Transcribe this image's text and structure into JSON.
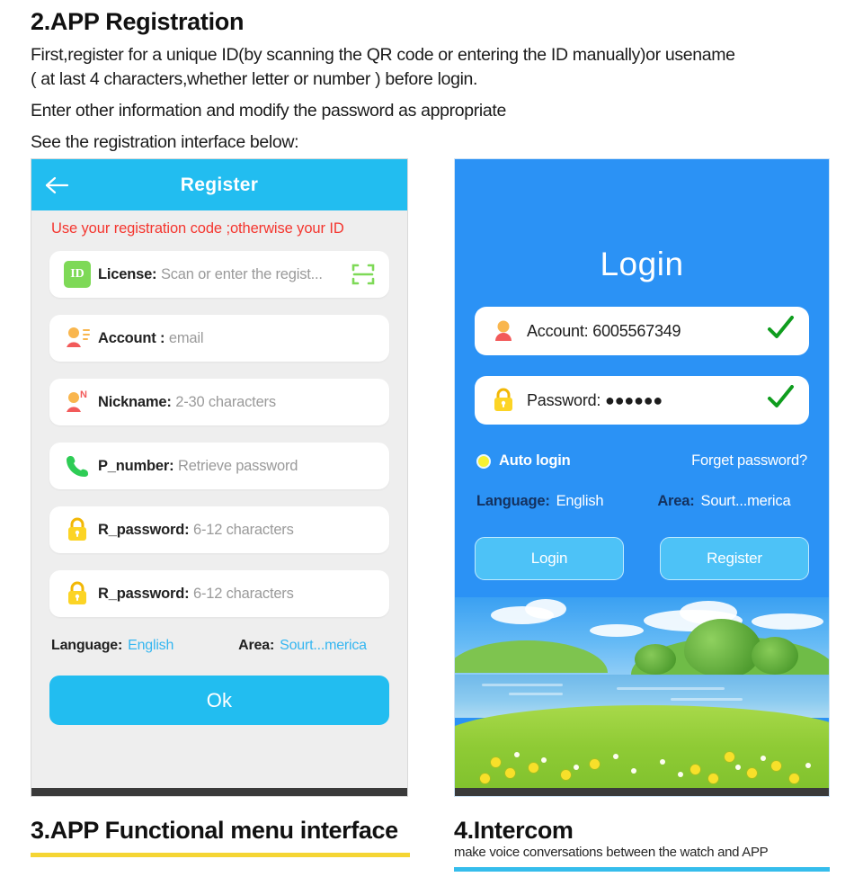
{
  "document": {
    "heading": "2.APP Registration",
    "paragraphs": [
      "First,register for a unique ID(by scanning the QR code or entering the ID manually)or usename",
      "( at last 4 characters,whether letter or number ) before login.",
      "Enter other information and modify the password as appropriate",
      "See the registration interface below:"
    ]
  },
  "register_screen": {
    "back_icon": "arrow-left-icon",
    "title": "Register",
    "warning": "Use your registration code ;otherwise your ID",
    "header_color": "#22bdf0",
    "background_color": "#eeeeee",
    "fields": [
      {
        "icon": "id-badge-icon",
        "icon_text": "ID",
        "label": "License:",
        "value": "Scan or enter the regist...",
        "trailing_icon": "qr-scan-icon"
      },
      {
        "icon": "account-person-icon",
        "label": "Account :",
        "value": "email",
        "trailing_icon": ""
      },
      {
        "icon": "nickname-person-icon",
        "label": "Nickname:",
        "value": "2-30 characters",
        "trailing_icon": ""
      },
      {
        "icon": "phone-icon",
        "label": "P_number:",
        "value": "Retrieve password",
        "trailing_icon": ""
      },
      {
        "icon": "lock-icon",
        "label": "R_password:",
        "value": "6-12 characters",
        "trailing_icon": ""
      },
      {
        "icon": "lock-icon",
        "label": "R_password:",
        "value": "6-12 characters",
        "trailing_icon": ""
      }
    ],
    "language_label": "Language:",
    "language_value": "English",
    "area_label": "Area:",
    "area_value": "Sourt...merica",
    "ok_button": "Ok"
  },
  "login_screen": {
    "title": "Login",
    "background_color": "#2b92f5",
    "account": {
      "icon": "account-person-icon",
      "label": "Account:",
      "value": "6005567349",
      "valid_icon": "check-mark-icon"
    },
    "password": {
      "icon": "lock-icon",
      "label": "Password:",
      "value": "●●●●●●",
      "valid_icon": "check-mark-icon"
    },
    "auto_login_label": "Auto login",
    "auto_login_checked": true,
    "forget_password_link": "Forget password?",
    "language_label": "Language:",
    "language_value": "English",
    "area_label": "Area:",
    "area_value": "Sourt...merica",
    "login_button": "Login",
    "register_button": "Register"
  },
  "section_3": {
    "title": "3.APP Functional menu interface",
    "rule_color": "#f5d533"
  },
  "section_4": {
    "title": "4.Intercom",
    "subtitle": "make voice conversations between the watch and APP",
    "rule_color": "#35bdec"
  }
}
